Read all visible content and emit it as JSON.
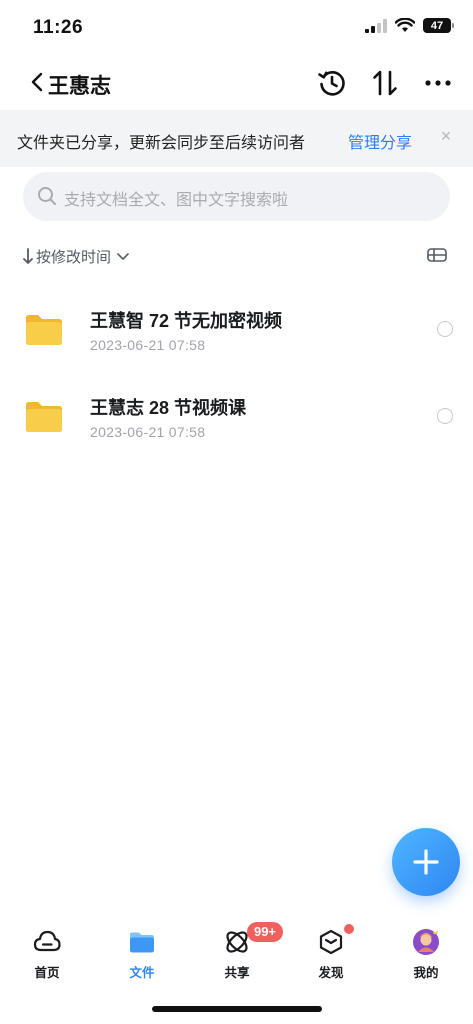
{
  "status_bar": {
    "time": "11:26",
    "battery": "47"
  },
  "nav": {
    "title": "王惠志"
  },
  "banner": {
    "text": "文件夹已分享，更新会同步至后续访问者",
    "action": "管理分享",
    "close": "×"
  },
  "search": {
    "placeholder": "支持文档全文、图中文字搜索啦"
  },
  "sort": {
    "label": "按修改时间"
  },
  "files": [
    {
      "name": "王慧智 72 节无加密视频",
      "date": "2023-06-21 07:58"
    },
    {
      "name": "王慧志 28 节视频课",
      "date": "2023-06-21 07:58"
    }
  ],
  "tabs": [
    {
      "label": "首页"
    },
    {
      "label": "文件"
    },
    {
      "label": "共享",
      "badge": "99+"
    },
    {
      "label": "发现"
    },
    {
      "label": "我的"
    }
  ],
  "colors": {
    "accent": "#2f86f2",
    "badge": "#f0605e",
    "folder": "#f8c944"
  }
}
